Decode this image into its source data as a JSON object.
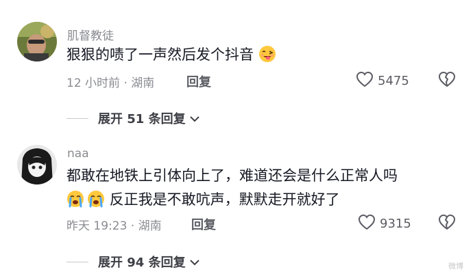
{
  "comments": [
    {
      "username": "肌督教徒",
      "text": "狠狠的啧了一声然后发个抖音",
      "time_location": "12 小时前 · 湖南",
      "reply_label": "回复",
      "likes": "5475",
      "expand_label": "展开 51 条回复",
      "emoji": "wink-tongue-emoji"
    },
    {
      "username": "naa",
      "text_line1": "都敢在地铁上引体向上了，难道还会是什么正常人吗",
      "text_line2": "反正我是不敢吭声，默默走开就好了",
      "time_location": "昨天 19:23 · 湖南",
      "reply_label": "回复",
      "likes": "9315",
      "expand_label": "展开 94 条回复",
      "emoji": "crying-emoji"
    }
  ],
  "watermark": "微博",
  "colors": {
    "primary_text": "#161823",
    "secondary_text": "#8a8b91",
    "emoji_yellow": "#ffc83d"
  }
}
